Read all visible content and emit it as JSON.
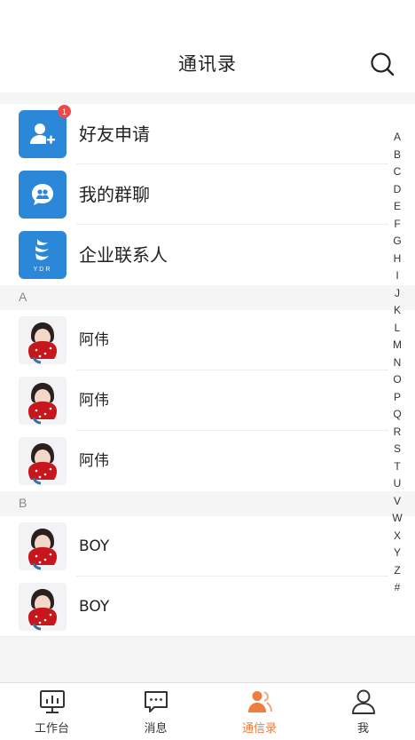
{
  "header": {
    "title": "通讯录"
  },
  "system_entries": [
    {
      "label": "好友申请",
      "icon": "add-user-icon",
      "badge": "1"
    },
    {
      "label": "我的群聊",
      "icon": "group-chat-icon"
    },
    {
      "label": "企业联系人",
      "icon": "company-logo-icon",
      "logo_text": "YDR"
    }
  ],
  "sections": [
    {
      "letter": "A",
      "contacts": [
        {
          "name": "阿伟"
        },
        {
          "name": "阿伟"
        },
        {
          "name": "阿伟"
        }
      ]
    },
    {
      "letter": "B",
      "contacts": [
        {
          "name": "BOY"
        },
        {
          "name": "BOY"
        }
      ]
    }
  ],
  "alpha_index": [
    "A",
    "B",
    "C",
    "D",
    "E",
    "F",
    "G",
    "H",
    "I",
    "J",
    "K",
    "L",
    "M",
    "N",
    "O",
    "P",
    "Q",
    "R",
    "S",
    "T",
    "U",
    "V",
    "W",
    "X",
    "Y",
    "Z",
    "#"
  ],
  "tabbar": [
    {
      "label": "工作台",
      "icon": "monitor-chart-icon",
      "active": false
    },
    {
      "label": "消息",
      "icon": "chat-bubble-icon",
      "active": false
    },
    {
      "label": "通信录",
      "icon": "contacts-icon",
      "active": true
    },
    {
      "label": "我",
      "icon": "person-icon",
      "active": false
    }
  ],
  "colors": {
    "accent_blue": "#2b88d8",
    "active_tab": "#ef7d3f",
    "badge": "#f04848"
  }
}
